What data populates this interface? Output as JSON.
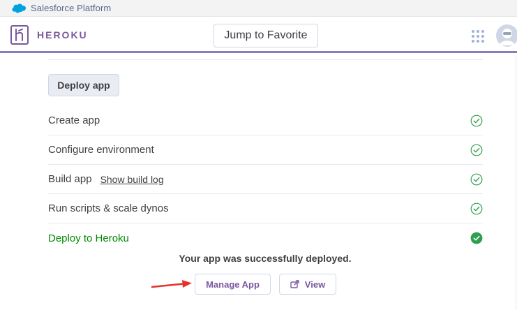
{
  "platform_bar": {
    "label": "Salesforce Platform",
    "icon": "salesforce-cloud-icon"
  },
  "header": {
    "brand": "HEROKU",
    "logo_icon": "heroku-logo-icon",
    "jump_label": "Jump to Favorite",
    "apps_icon": "apps-grid-icon",
    "avatar_icon": "user-avatar-icon",
    "accent_color": "#79589f"
  },
  "deploy": {
    "button_label": "Deploy app",
    "steps": [
      {
        "label": "Create app",
        "status": "complete"
      },
      {
        "label": "Configure environment",
        "status": "complete"
      },
      {
        "label": "Build app",
        "link": "Show build log",
        "status": "complete"
      },
      {
        "label": "Run scripts & scale dynos",
        "status": "complete"
      },
      {
        "label": "Deploy to Heroku",
        "status": "success"
      }
    ],
    "success_message": "Your app was successfully deployed.",
    "manage_label": "Manage App",
    "view_label": "View",
    "success_color": "#008a00"
  }
}
